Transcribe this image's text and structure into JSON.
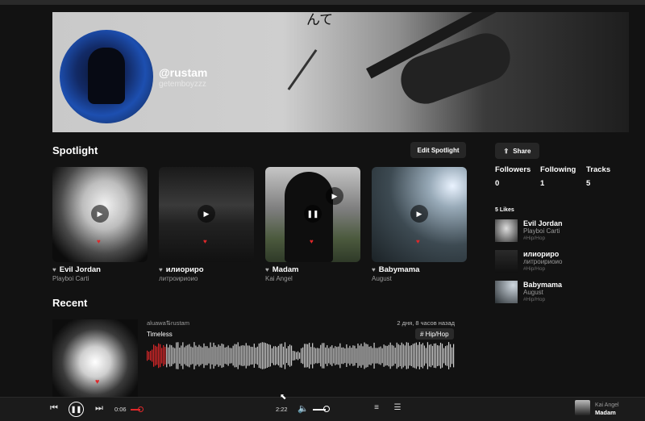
{
  "profile": {
    "username": "@rustam",
    "handle": "getemboyzzz",
    "banner_glyph": "んて"
  },
  "spotlight": {
    "title": "Spotlight",
    "edit_label": "Edit Spotlight",
    "tracks": [
      {
        "title": "Evil Jordan",
        "artist": "Playboi Carti",
        "state": "paused"
      },
      {
        "title": "илиориро",
        "artist": "литроириоио",
        "state": "paused"
      },
      {
        "title": "Madam",
        "artist": "Kai Angel",
        "state": "playing"
      },
      {
        "title": "Babymama",
        "artist": "August",
        "state": "paused"
      }
    ]
  },
  "sidebar": {
    "share_label": "Share",
    "stats": [
      {
        "label": "Followers",
        "value": "0"
      },
      {
        "label": "Following",
        "value": "1"
      },
      {
        "label": "Tracks",
        "value": "5"
      }
    ],
    "likes_title": "5 Likes",
    "likes": [
      {
        "title": "Evil Jordan",
        "artist": "Playboi Carti",
        "genre": "#Hip/Hop"
      },
      {
        "title": "илиориро",
        "artist": "литроириоио",
        "genre": "#Hip/Hop"
      },
      {
        "title": "Babymama",
        "artist": "August",
        "genre": "#Hip/Hop"
      }
    ]
  },
  "recent": {
    "title": "Recent",
    "item": {
      "user_line": "aluawa⇅rustam",
      "time": "2 дня, 8 часов назад",
      "track": "Timeless",
      "tag": "# Hip/Hop",
      "progress": 0.06
    }
  },
  "player": {
    "elapsed": "0:06",
    "duration": "2:22",
    "volume": 0.35,
    "now_playing": {
      "artist": "Kai Angel",
      "title": "Madam"
    }
  },
  "colors": {
    "accent": "#e0282a",
    "background": "#121212",
    "player_bg": "#1b1b1b"
  }
}
